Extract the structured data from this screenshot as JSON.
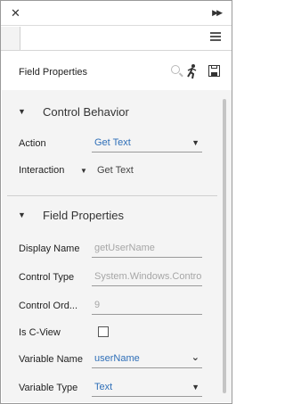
{
  "window": {
    "close_glyph": "✕",
    "skip_glyph": "▶▶"
  },
  "header": {
    "title": "Field Properties",
    "icons": [
      "search-icon",
      "runner-icon",
      "save-icon"
    ]
  },
  "sections": {
    "control_behavior": {
      "title": "Control Behavior",
      "action": {
        "label": "Action",
        "value": "Get Text"
      },
      "interaction": {
        "label": "Interaction",
        "value": "Get Text"
      }
    },
    "field_properties": {
      "title": "Field Properties",
      "display_name": {
        "label": "Display Name",
        "value": "getUserName"
      },
      "control_type": {
        "label": "Control Type",
        "value": "System.Windows.Controls.T"
      },
      "control_order": {
        "label": "Control Ord...",
        "value": "9"
      },
      "is_cview": {
        "label": "Is C-View",
        "checked": false
      },
      "variable_name": {
        "label": "Variable Name",
        "value": "userName"
      },
      "variable_type": {
        "label": "Variable Type",
        "value": "Text"
      }
    }
  },
  "colors": {
    "accent": "#2f6fb8",
    "panel_bg": "#f4f4f4",
    "disabled_text": "#a6a6a6"
  }
}
